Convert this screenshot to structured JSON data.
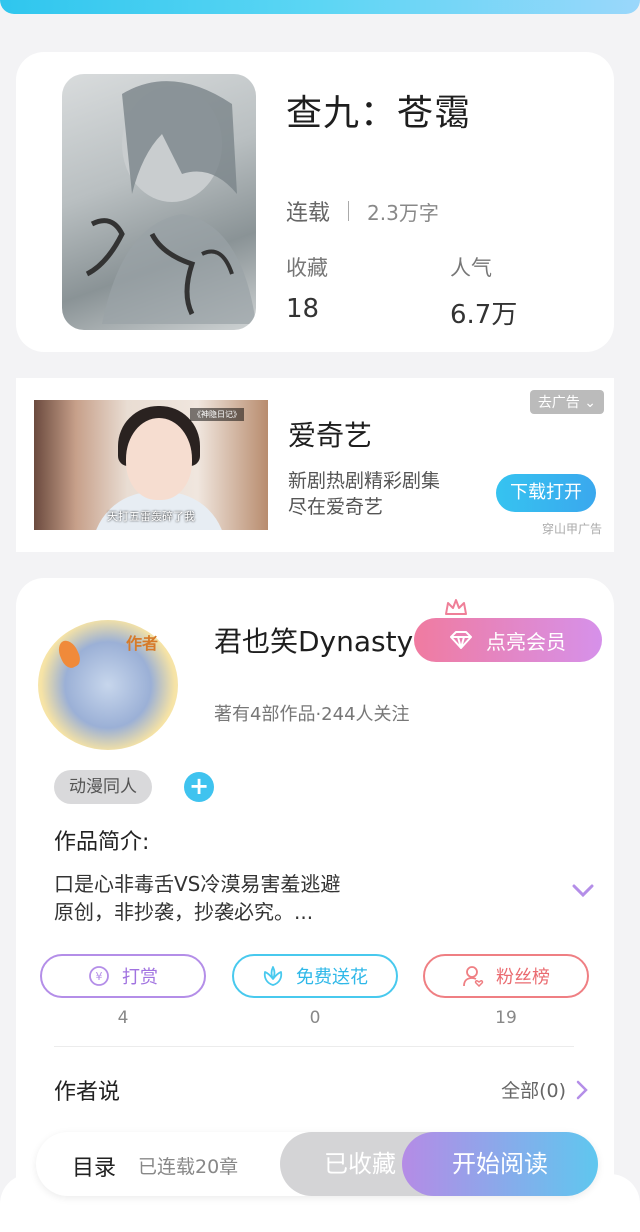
{
  "book": {
    "title": "查九：苍霭",
    "status": "连载",
    "word_count": "2.3万字",
    "stats": [
      {
        "label": "收藏",
        "value": "18"
      },
      {
        "label": "人气",
        "value": "6.7万"
      }
    ]
  },
  "ad": {
    "remove_label": "去广告",
    "title": "爱奇艺",
    "desc_line1": "新剧热剧精彩剧集",
    "desc_line2": "尽在爱奇艺",
    "button": "下载打开",
    "source": "穿山甲广告",
    "image_subtitle": "天打五雷轰碎了我",
    "image_tag": "《神隐日记》"
  },
  "author": {
    "avatar_badge": "作者",
    "name": "君也笑Dynasty",
    "vip_button": "点亮会员",
    "meta": "著有4部作品·244人关注",
    "tag": "动漫同人",
    "intro_title": "作品简介:",
    "intro_line1": "口是心非毒舌VS冷漠易害羞逃避",
    "intro_line2": "原创，非抄袭，抄袭必究。..."
  },
  "actions": [
    {
      "label": "打赏",
      "count": "4",
      "icon": "coin-icon"
    },
    {
      "label": "免费送花",
      "count": "0",
      "icon": "flower-icon"
    },
    {
      "label": "粉丝榜",
      "count": "19",
      "icon": "fan-icon"
    }
  ],
  "author_says": {
    "title": "作者说",
    "all_label": "全部(0)"
  },
  "reading_bar": {
    "toc": "目录",
    "chapters": "已连载20章",
    "collected": "已收藏",
    "read": "开始阅读"
  },
  "colors": {
    "accent_blue": "#3fc3ef",
    "vip_gradient_start": "#f07ba0",
    "vip_gradient_end": "#d691ea",
    "read_gradient_start": "#b58be6",
    "read_gradient_end": "#5fc7ef"
  }
}
